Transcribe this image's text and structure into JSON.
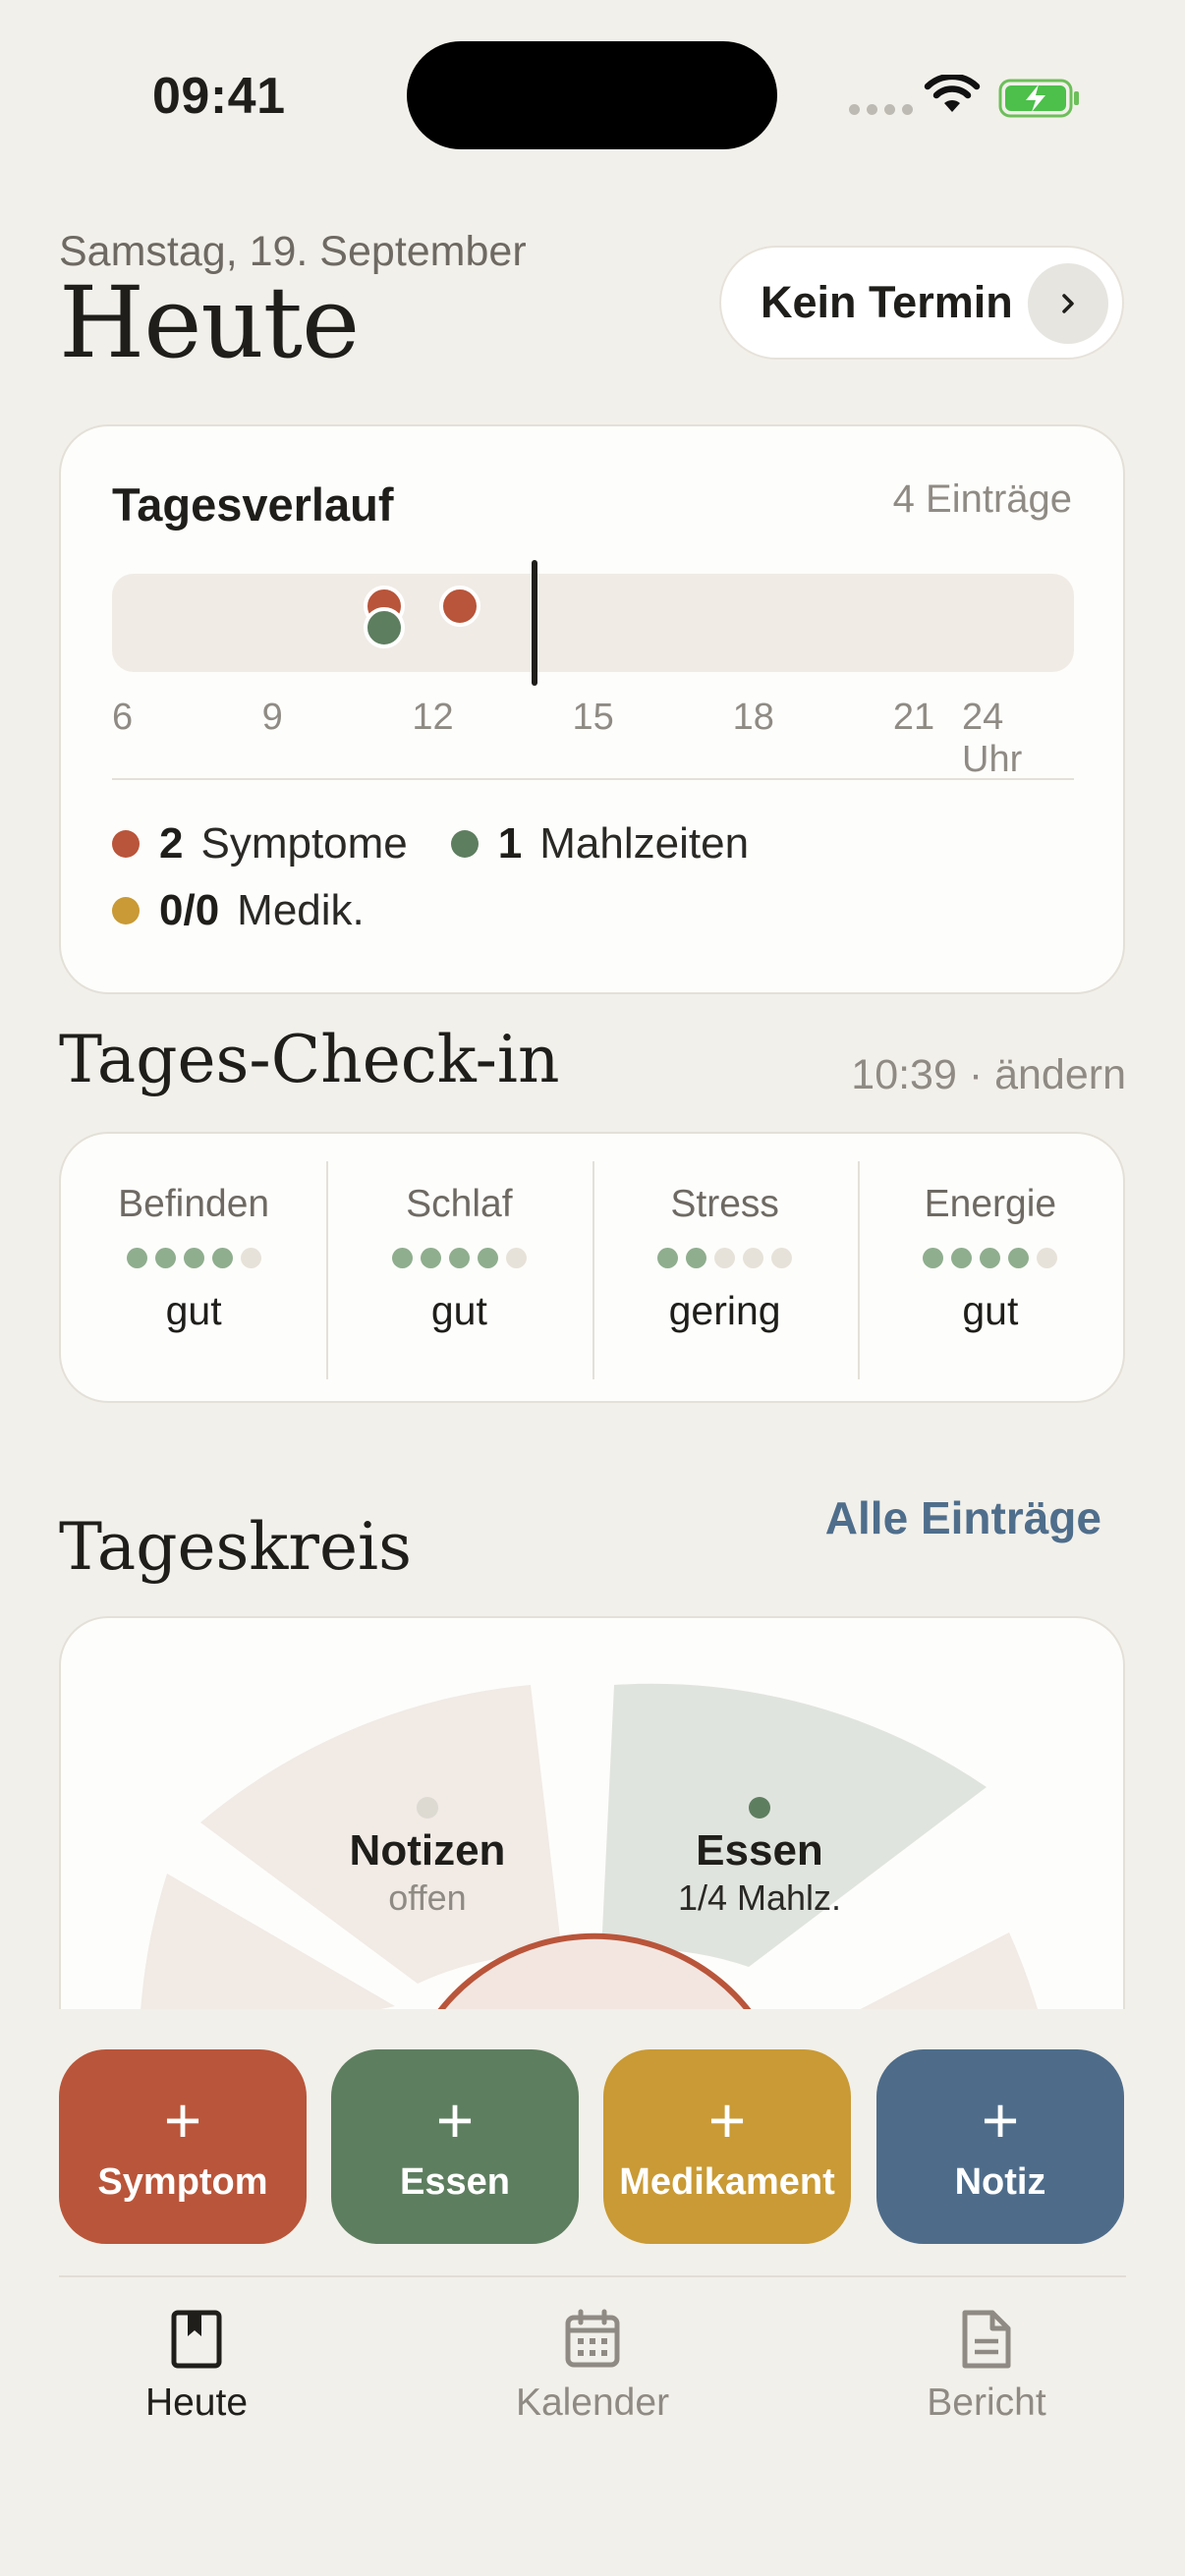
{
  "status_bar": {
    "time": "09:41"
  },
  "header": {
    "date": "Samstag, 19. September",
    "title": "Heute",
    "appointment_label": "Kein Termin"
  },
  "timeline": {
    "title": "Tagesverlauf",
    "count": "4 Einträge",
    "axis_labels": [
      "6",
      "9",
      "12",
      "15",
      "18",
      "21",
      "24 Uhr"
    ],
    "now_hour": 13.9,
    "events": [
      {
        "type": "symptom",
        "hour": 11.1
      },
      {
        "type": "meal",
        "hour": 11.1
      },
      {
        "type": "symptom",
        "hour": 12.5
      }
    ],
    "legend": [
      {
        "count": "2",
        "label": "Symptome",
        "color": "#B9553A"
      },
      {
        "count": "1",
        "label": "Mahlzeiten",
        "color": "#5E7E60"
      },
      {
        "count": "0/0",
        "label": "Medik.",
        "color": "#C99A35"
      }
    ]
  },
  "checkin": {
    "heading": "Tages-Check-in",
    "time_edit": "10:39 · ändern",
    "items": [
      {
        "label": "Befinden",
        "value": "gut",
        "filled": 4
      },
      {
        "label": "Schlaf",
        "value": "gut",
        "filled": 4
      },
      {
        "label": "Stress",
        "value": "gering",
        "filled": 2
      },
      {
        "label": "Energie",
        "value": "gut",
        "filled": 4
      }
    ]
  },
  "circle": {
    "heading": "Tageskreis",
    "all_entries": "Alle Einträge",
    "segments": [
      {
        "title": "Notizen",
        "subtitle": "offen"
      },
      {
        "title": "Essen",
        "subtitle": "1/4 Mahlz."
      }
    ]
  },
  "actions": [
    {
      "label": "Symptom",
      "plus": "+",
      "color": "#B9553A"
    },
    {
      "label": "Essen",
      "plus": "+",
      "color": "#5E7E60"
    },
    {
      "label": "Medikament",
      "plus": "+",
      "color": "#C99A35"
    },
    {
      "label": "Notiz",
      "plus": "+",
      "color": "#4E6C8A"
    }
  ],
  "tabs": [
    {
      "label": "Heute",
      "icon": "book-icon",
      "active": true
    },
    {
      "label": "Kalender",
      "icon": "calendar-icon",
      "active": false
    },
    {
      "label": "Bericht",
      "icon": "document-icon",
      "active": false
    }
  ],
  "colors": {
    "background": "#F2F0EA",
    "symptom": "#B9553A",
    "meal": "#5E7E60",
    "medication": "#C99A35",
    "note": "#4E6C8A",
    "dot_filled": "#8FAE8E",
    "dot_empty": "#E7E2D9"
  }
}
